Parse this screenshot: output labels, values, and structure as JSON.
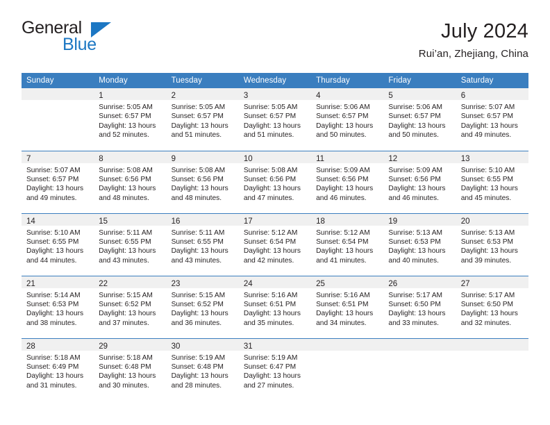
{
  "brand": {
    "word_one": "General",
    "word_two": "Blue",
    "triangle_icon": "triangle-icon"
  },
  "header": {
    "title": "July 2024",
    "subtitle": "Rui’an, Zhejiang, China"
  },
  "colors": {
    "header_blue": "#3a7ebf",
    "brand_blue": "#1c77c3",
    "band_gray": "#f0f0f0",
    "text": "#231f20"
  },
  "weekdays": [
    "Sunday",
    "Monday",
    "Tuesday",
    "Wednesday",
    "Thursday",
    "Friday",
    "Saturday"
  ],
  "labels": {
    "sunrise": "Sunrise:",
    "sunset": "Sunset:",
    "daylight": "Daylight:"
  },
  "weeks": [
    [
      {
        "day": "",
        "empty": true,
        "lines": []
      },
      {
        "day": "1",
        "lines": [
          "Sunrise: 5:05 AM",
          "Sunset: 6:57 PM",
          "Daylight: 13 hours",
          "and 52 minutes."
        ]
      },
      {
        "day": "2",
        "lines": [
          "Sunrise: 5:05 AM",
          "Sunset: 6:57 PM",
          "Daylight: 13 hours",
          "and 51 minutes."
        ]
      },
      {
        "day": "3",
        "lines": [
          "Sunrise: 5:05 AM",
          "Sunset: 6:57 PM",
          "Daylight: 13 hours",
          "and 51 minutes."
        ]
      },
      {
        "day": "4",
        "lines": [
          "Sunrise: 5:06 AM",
          "Sunset: 6:57 PM",
          "Daylight: 13 hours",
          "and 50 minutes."
        ]
      },
      {
        "day": "5",
        "lines": [
          "Sunrise: 5:06 AM",
          "Sunset: 6:57 PM",
          "Daylight: 13 hours",
          "and 50 minutes."
        ]
      },
      {
        "day": "6",
        "lines": [
          "Sunrise: 5:07 AM",
          "Sunset: 6:57 PM",
          "Daylight: 13 hours",
          "and 49 minutes."
        ]
      }
    ],
    [
      {
        "day": "7",
        "lines": [
          "Sunrise: 5:07 AM",
          "Sunset: 6:57 PM",
          "Daylight: 13 hours",
          "and 49 minutes."
        ]
      },
      {
        "day": "8",
        "lines": [
          "Sunrise: 5:08 AM",
          "Sunset: 6:56 PM",
          "Daylight: 13 hours",
          "and 48 minutes."
        ]
      },
      {
        "day": "9",
        "lines": [
          "Sunrise: 5:08 AM",
          "Sunset: 6:56 PM",
          "Daylight: 13 hours",
          "and 48 minutes."
        ]
      },
      {
        "day": "10",
        "lines": [
          "Sunrise: 5:08 AM",
          "Sunset: 6:56 PM",
          "Daylight: 13 hours",
          "and 47 minutes."
        ]
      },
      {
        "day": "11",
        "lines": [
          "Sunrise: 5:09 AM",
          "Sunset: 6:56 PM",
          "Daylight: 13 hours",
          "and 46 minutes."
        ]
      },
      {
        "day": "12",
        "lines": [
          "Sunrise: 5:09 AM",
          "Sunset: 6:56 PM",
          "Daylight: 13 hours",
          "and 46 minutes."
        ]
      },
      {
        "day": "13",
        "lines": [
          "Sunrise: 5:10 AM",
          "Sunset: 6:55 PM",
          "Daylight: 13 hours",
          "and 45 minutes."
        ]
      }
    ],
    [
      {
        "day": "14",
        "lines": [
          "Sunrise: 5:10 AM",
          "Sunset: 6:55 PM",
          "Daylight: 13 hours",
          "and 44 minutes."
        ]
      },
      {
        "day": "15",
        "lines": [
          "Sunrise: 5:11 AM",
          "Sunset: 6:55 PM",
          "Daylight: 13 hours",
          "and 43 minutes."
        ]
      },
      {
        "day": "16",
        "lines": [
          "Sunrise: 5:11 AM",
          "Sunset: 6:55 PM",
          "Daylight: 13 hours",
          "and 43 minutes."
        ]
      },
      {
        "day": "17",
        "lines": [
          "Sunrise: 5:12 AM",
          "Sunset: 6:54 PM",
          "Daylight: 13 hours",
          "and 42 minutes."
        ]
      },
      {
        "day": "18",
        "lines": [
          "Sunrise: 5:12 AM",
          "Sunset: 6:54 PM",
          "Daylight: 13 hours",
          "and 41 minutes."
        ]
      },
      {
        "day": "19",
        "lines": [
          "Sunrise: 5:13 AM",
          "Sunset: 6:53 PM",
          "Daylight: 13 hours",
          "and 40 minutes."
        ]
      },
      {
        "day": "20",
        "lines": [
          "Sunrise: 5:13 AM",
          "Sunset: 6:53 PM",
          "Daylight: 13 hours",
          "and 39 minutes."
        ]
      }
    ],
    [
      {
        "day": "21",
        "lines": [
          "Sunrise: 5:14 AM",
          "Sunset: 6:53 PM",
          "Daylight: 13 hours",
          "and 38 minutes."
        ]
      },
      {
        "day": "22",
        "lines": [
          "Sunrise: 5:15 AM",
          "Sunset: 6:52 PM",
          "Daylight: 13 hours",
          "and 37 minutes."
        ]
      },
      {
        "day": "23",
        "lines": [
          "Sunrise: 5:15 AM",
          "Sunset: 6:52 PM",
          "Daylight: 13 hours",
          "and 36 minutes."
        ]
      },
      {
        "day": "24",
        "lines": [
          "Sunrise: 5:16 AM",
          "Sunset: 6:51 PM",
          "Daylight: 13 hours",
          "and 35 minutes."
        ]
      },
      {
        "day": "25",
        "lines": [
          "Sunrise: 5:16 AM",
          "Sunset: 6:51 PM",
          "Daylight: 13 hours",
          "and 34 minutes."
        ]
      },
      {
        "day": "26",
        "lines": [
          "Sunrise: 5:17 AM",
          "Sunset: 6:50 PM",
          "Daylight: 13 hours",
          "and 33 minutes."
        ]
      },
      {
        "day": "27",
        "lines": [
          "Sunrise: 5:17 AM",
          "Sunset: 6:50 PM",
          "Daylight: 13 hours",
          "and 32 minutes."
        ]
      }
    ],
    [
      {
        "day": "28",
        "lines": [
          "Sunrise: 5:18 AM",
          "Sunset: 6:49 PM",
          "Daylight: 13 hours",
          "and 31 minutes."
        ]
      },
      {
        "day": "29",
        "lines": [
          "Sunrise: 5:18 AM",
          "Sunset: 6:48 PM",
          "Daylight: 13 hours",
          "and 30 minutes."
        ]
      },
      {
        "day": "30",
        "lines": [
          "Sunrise: 5:19 AM",
          "Sunset: 6:48 PM",
          "Daylight: 13 hours",
          "and 28 minutes."
        ]
      },
      {
        "day": "31",
        "lines": [
          "Sunrise: 5:19 AM",
          "Sunset: 6:47 PM",
          "Daylight: 13 hours",
          "and 27 minutes."
        ]
      },
      {
        "day": "",
        "empty": true,
        "lines": []
      },
      {
        "day": "",
        "empty": true,
        "lines": []
      },
      {
        "day": "",
        "empty": true,
        "lines": []
      }
    ]
  ]
}
